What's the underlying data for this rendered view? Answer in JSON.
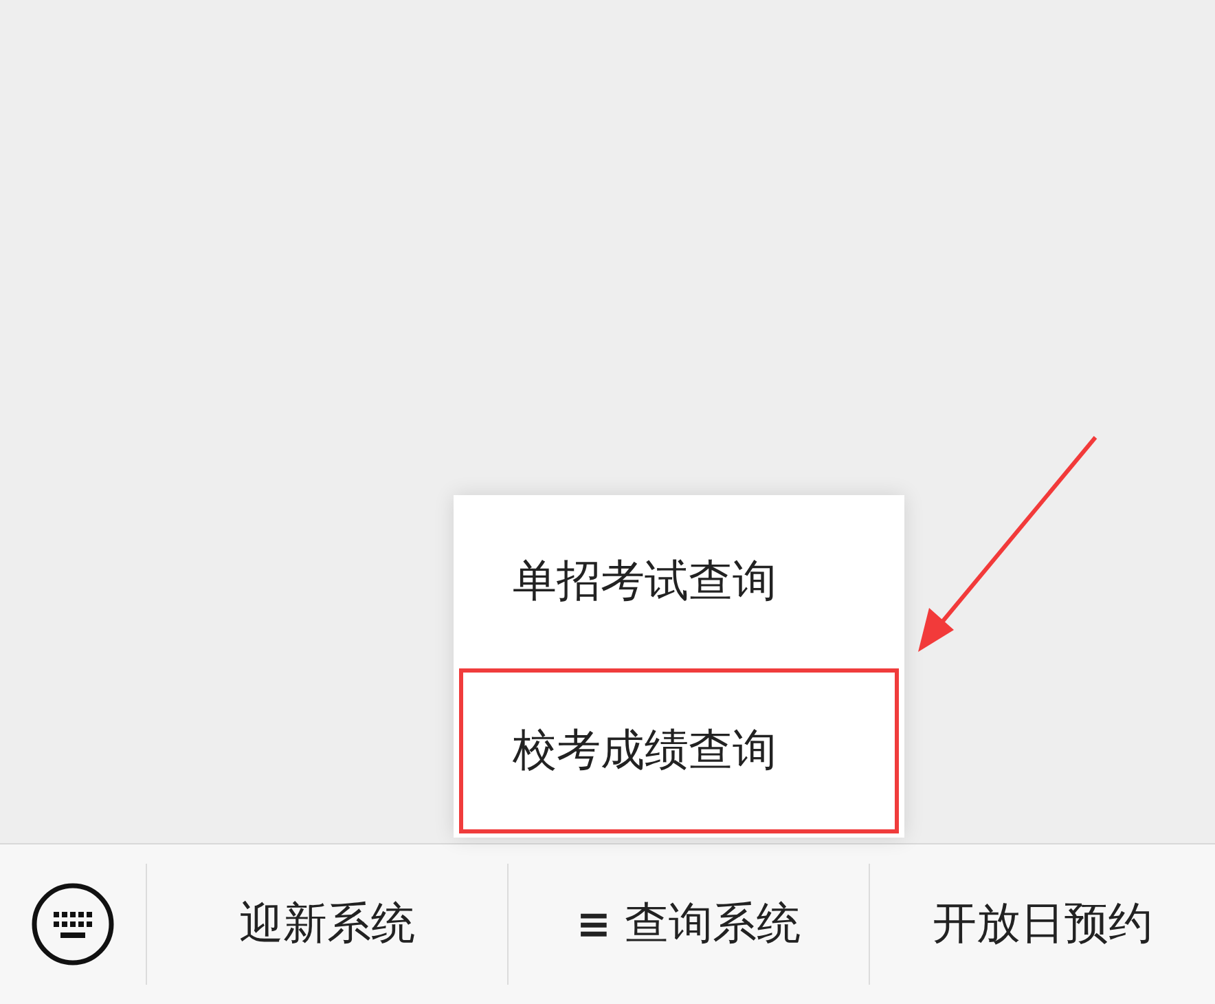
{
  "popup_menu": {
    "items": [
      {
        "label": "单招考试查询",
        "highlighted": false
      },
      {
        "label": "校考成绩查询",
        "highlighted": true
      }
    ]
  },
  "bottom_menu": {
    "items": [
      {
        "kind": "keyboard"
      },
      {
        "kind": "menu",
        "label": "迎新系统"
      },
      {
        "kind": "menu",
        "icon": "≡",
        "label": "查询系统"
      },
      {
        "kind": "menu",
        "label": "开放日预约"
      }
    ]
  }
}
